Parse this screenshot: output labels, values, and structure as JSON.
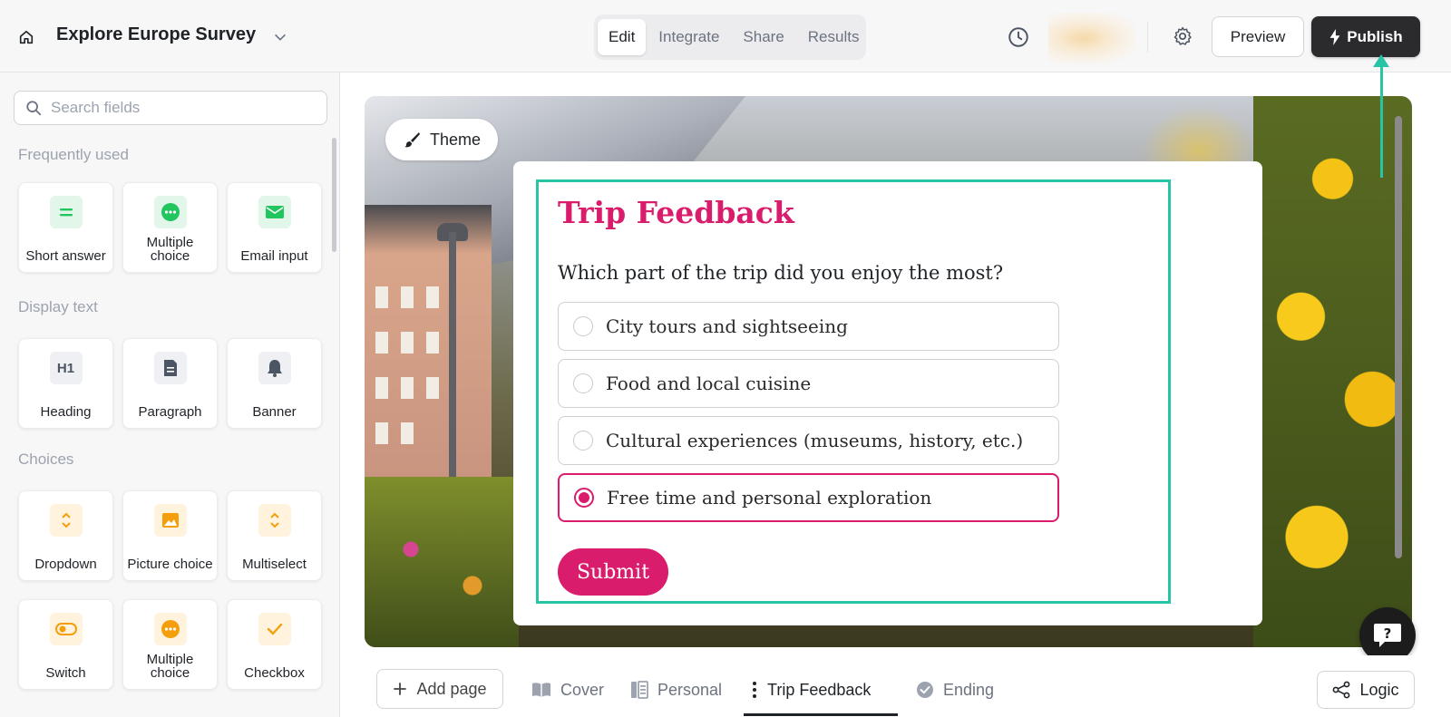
{
  "header": {
    "survey_title": "Explore Europe Survey",
    "tabs": [
      {
        "label": "Edit",
        "active": true
      },
      {
        "label": "Integrate",
        "active": false
      },
      {
        "label": "Share",
        "active": false
      },
      {
        "label": "Results",
        "active": false
      }
    ],
    "preview_label": "Preview",
    "publish_label": "Publish"
  },
  "sidebar": {
    "search_placeholder": "Search fields",
    "sections": [
      {
        "title": "Frequently used",
        "items": [
          {
            "label": "Short answer",
            "icon": "equals-icon"
          },
          {
            "label": "Multiple choice",
            "icon": "dots-circle-icon"
          },
          {
            "label": "Email input",
            "icon": "envelope-icon"
          }
        ]
      },
      {
        "title": "Display text",
        "items": [
          {
            "label": "Heading",
            "icon": "h1-icon"
          },
          {
            "label": "Paragraph",
            "icon": "document-icon"
          },
          {
            "label": "Banner",
            "icon": "bell-icon"
          }
        ]
      },
      {
        "title": "Choices",
        "items": [
          {
            "label": "Dropdown",
            "icon": "chevron-updown-icon"
          },
          {
            "label": "Picture choice",
            "icon": "image-icon"
          },
          {
            "label": "Multiselect",
            "icon": "chevron-updown-icon"
          },
          {
            "label": "Switch",
            "icon": "toggle-icon"
          },
          {
            "label": "Multiple choice",
            "icon": "dots-circle-icon"
          },
          {
            "label": "Checkbox",
            "icon": "check-icon"
          }
        ]
      }
    ]
  },
  "canvas": {
    "theme_label": "Theme",
    "form": {
      "title": "Trip Feedback",
      "question": "Which part of the trip did you enjoy the most?",
      "options": [
        {
          "label": "City tours and sightseeing",
          "selected": false
        },
        {
          "label": "Food and local cuisine",
          "selected": false
        },
        {
          "label": "Cultural experiences (museums, history, etc.)",
          "selected": false
        },
        {
          "label": "Free time and personal exploration",
          "selected": true
        }
      ],
      "submit_label": "Submit"
    }
  },
  "bottom_bar": {
    "add_page_label": "Add page",
    "pages": [
      {
        "label": "Cover",
        "icon": "book-icon",
        "active": false
      },
      {
        "label": "Personal",
        "icon": "form-icon",
        "active": false
      },
      {
        "label": "Trip Feedback",
        "icon": "vertical-dots-icon",
        "active": true
      },
      {
        "label": "Ending",
        "icon": "check-circle-icon",
        "active": false
      }
    ],
    "logic_label": "Logic"
  },
  "colors": {
    "accent": "#d91c6b",
    "highlight": "#27c4a6",
    "publish_bg": "#2b2b2e",
    "green_icon": "#22c55e",
    "orange_icon": "#f59e0b"
  }
}
